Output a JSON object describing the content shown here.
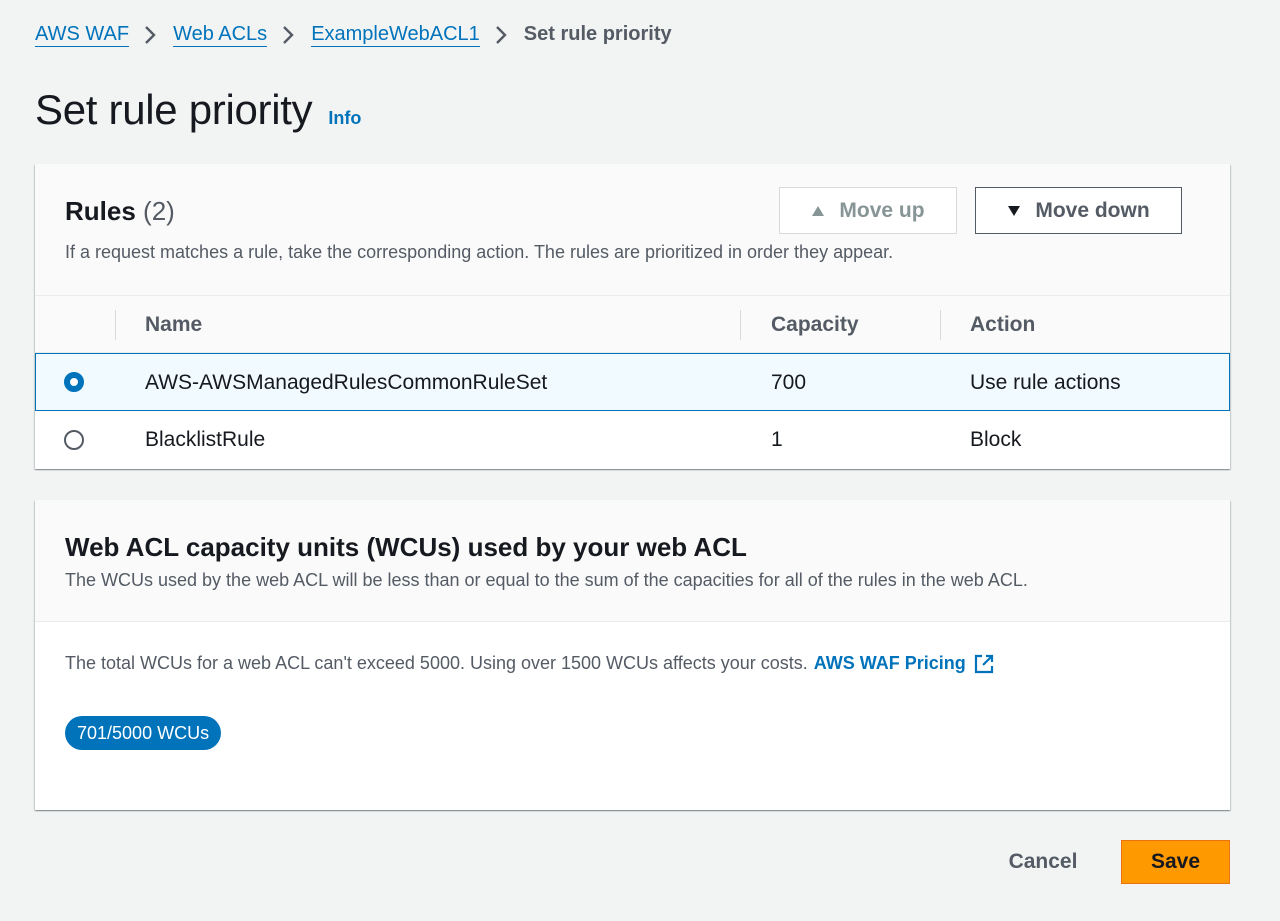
{
  "breadcrumb": {
    "items": [
      "AWS WAF",
      "Web ACLs",
      "ExampleWebACL1"
    ],
    "current": "Set rule priority"
  },
  "page": {
    "title": "Set rule priority",
    "info_label": "Info"
  },
  "rules": {
    "title": "Rules",
    "count": "(2)",
    "description": "If a request matches a rule, take the corresponding action. The rules are prioritized in order they appear.",
    "move_up_label": "Move up",
    "move_down_label": "Move down",
    "columns": [
      "Name",
      "Capacity",
      "Action"
    ],
    "rows": [
      {
        "name": "AWS-AWSManagedRulesCommonRuleSet",
        "capacity": "700",
        "action": "Use rule actions",
        "selected": true
      },
      {
        "name": "BlacklistRule",
        "capacity": "1",
        "action": "Block",
        "selected": false
      }
    ]
  },
  "wcu": {
    "title": "Web ACL capacity units (WCUs) used by your web ACL",
    "description": "The WCUs used by the web ACL will be less than or equal to the sum of the capacities for all of the rules in the web ACL.",
    "limit_text": "The total WCUs for a web ACL can't exceed 5000. Using over 1500 WCUs affects your costs.",
    "pricing_link": "AWS WAF Pricing",
    "badge": "701/5000 WCUs"
  },
  "footer": {
    "cancel_label": "Cancel",
    "save_label": "Save"
  },
  "colors": {
    "link": "#0073bb",
    "primary_button": "#ff9900",
    "selected_row_bg": "#f1faff",
    "background": "#f2f3f3"
  }
}
